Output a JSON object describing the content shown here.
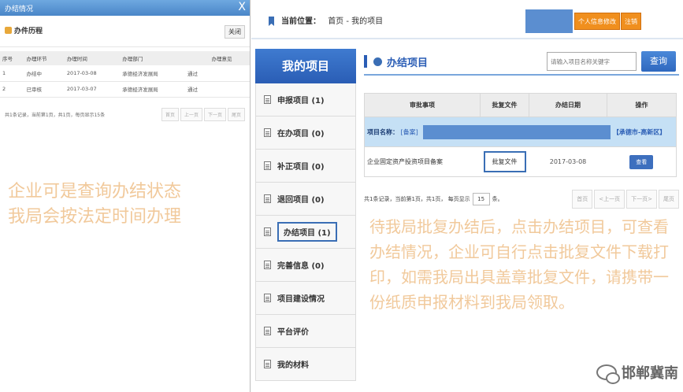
{
  "popup": {
    "window_title": "办结情况",
    "close_glyph": "X",
    "header_title": "办件历程",
    "close_button": "关闭",
    "columns": [
      "序号",
      "办理环节",
      "办理时间",
      "办理部门",
      "",
      "办理意见"
    ],
    "rows": [
      {
        "no": "1",
        "step": "办结中",
        "time": "2017-03-08",
        "dept": "承德经济发展局",
        "status": "通过",
        "opinion": ""
      },
      {
        "no": "2",
        "step": "已审核",
        "time": "2017-03-07",
        "dept": "承德经济发展局",
        "status": "通过",
        "opinion": ""
      }
    ],
    "pager_text": "共1条记录，当前第1页，共1页，每页显示15条",
    "pager_buttons": [
      "首页",
      "上一页",
      "下一页",
      "尾页"
    ],
    "note": [
      "企业可是查询办结状态",
      "我局会按法定时间办理"
    ]
  },
  "topbar": {
    "location_label": "当前位置：",
    "location_path": "首页 - 我的项目",
    "profile_button": "个人信息修改",
    "logout_button": "注销"
  },
  "sidebar": {
    "title": "我的项目",
    "items": [
      {
        "label": "申报项目 (1)"
      },
      {
        "label": "在办项目 (0)"
      },
      {
        "label": "补正项目 (0)"
      },
      {
        "label": "退回项目 (0)"
      },
      {
        "label": "办结项目 (1)"
      },
      {
        "label": "完善信息 (0)"
      },
      {
        "label": "项目建设情况"
      },
      {
        "label": "平台评价"
      },
      {
        "label": "我的材料"
      }
    ]
  },
  "content": {
    "section_title": "办结项目",
    "search_placeholder": "请输入项目名称关键字",
    "search_button": "查询",
    "table": {
      "columns": [
        "审批事项",
        "批复文件",
        "办结日期",
        "操作"
      ],
      "project_label": "项目名称：",
      "project_tag": "[备案]",
      "project_city": "【承德市-高新区】",
      "row": {
        "item": "企业固定资产投资项目备案",
        "file": "批复文件",
        "date": "2017-03-08",
        "action": "查看"
      }
    },
    "pager": {
      "text_before": "共1条记录，当前第1页，共1页， 每页显示",
      "page_size": "15",
      "text_after": "条。",
      "buttons": [
        "首页",
        "<上一页",
        "下一页>",
        "尾页"
      ]
    },
    "note": "待我局批复办结后，点击办结项目，可查看办结情况，企业可自行点击批复文件下载打印，如需我局出具盖章批复文件，请携带一份纸质申报材料到我局领取。"
  },
  "watermark": {
    "text": "邯郸冀南"
  }
}
